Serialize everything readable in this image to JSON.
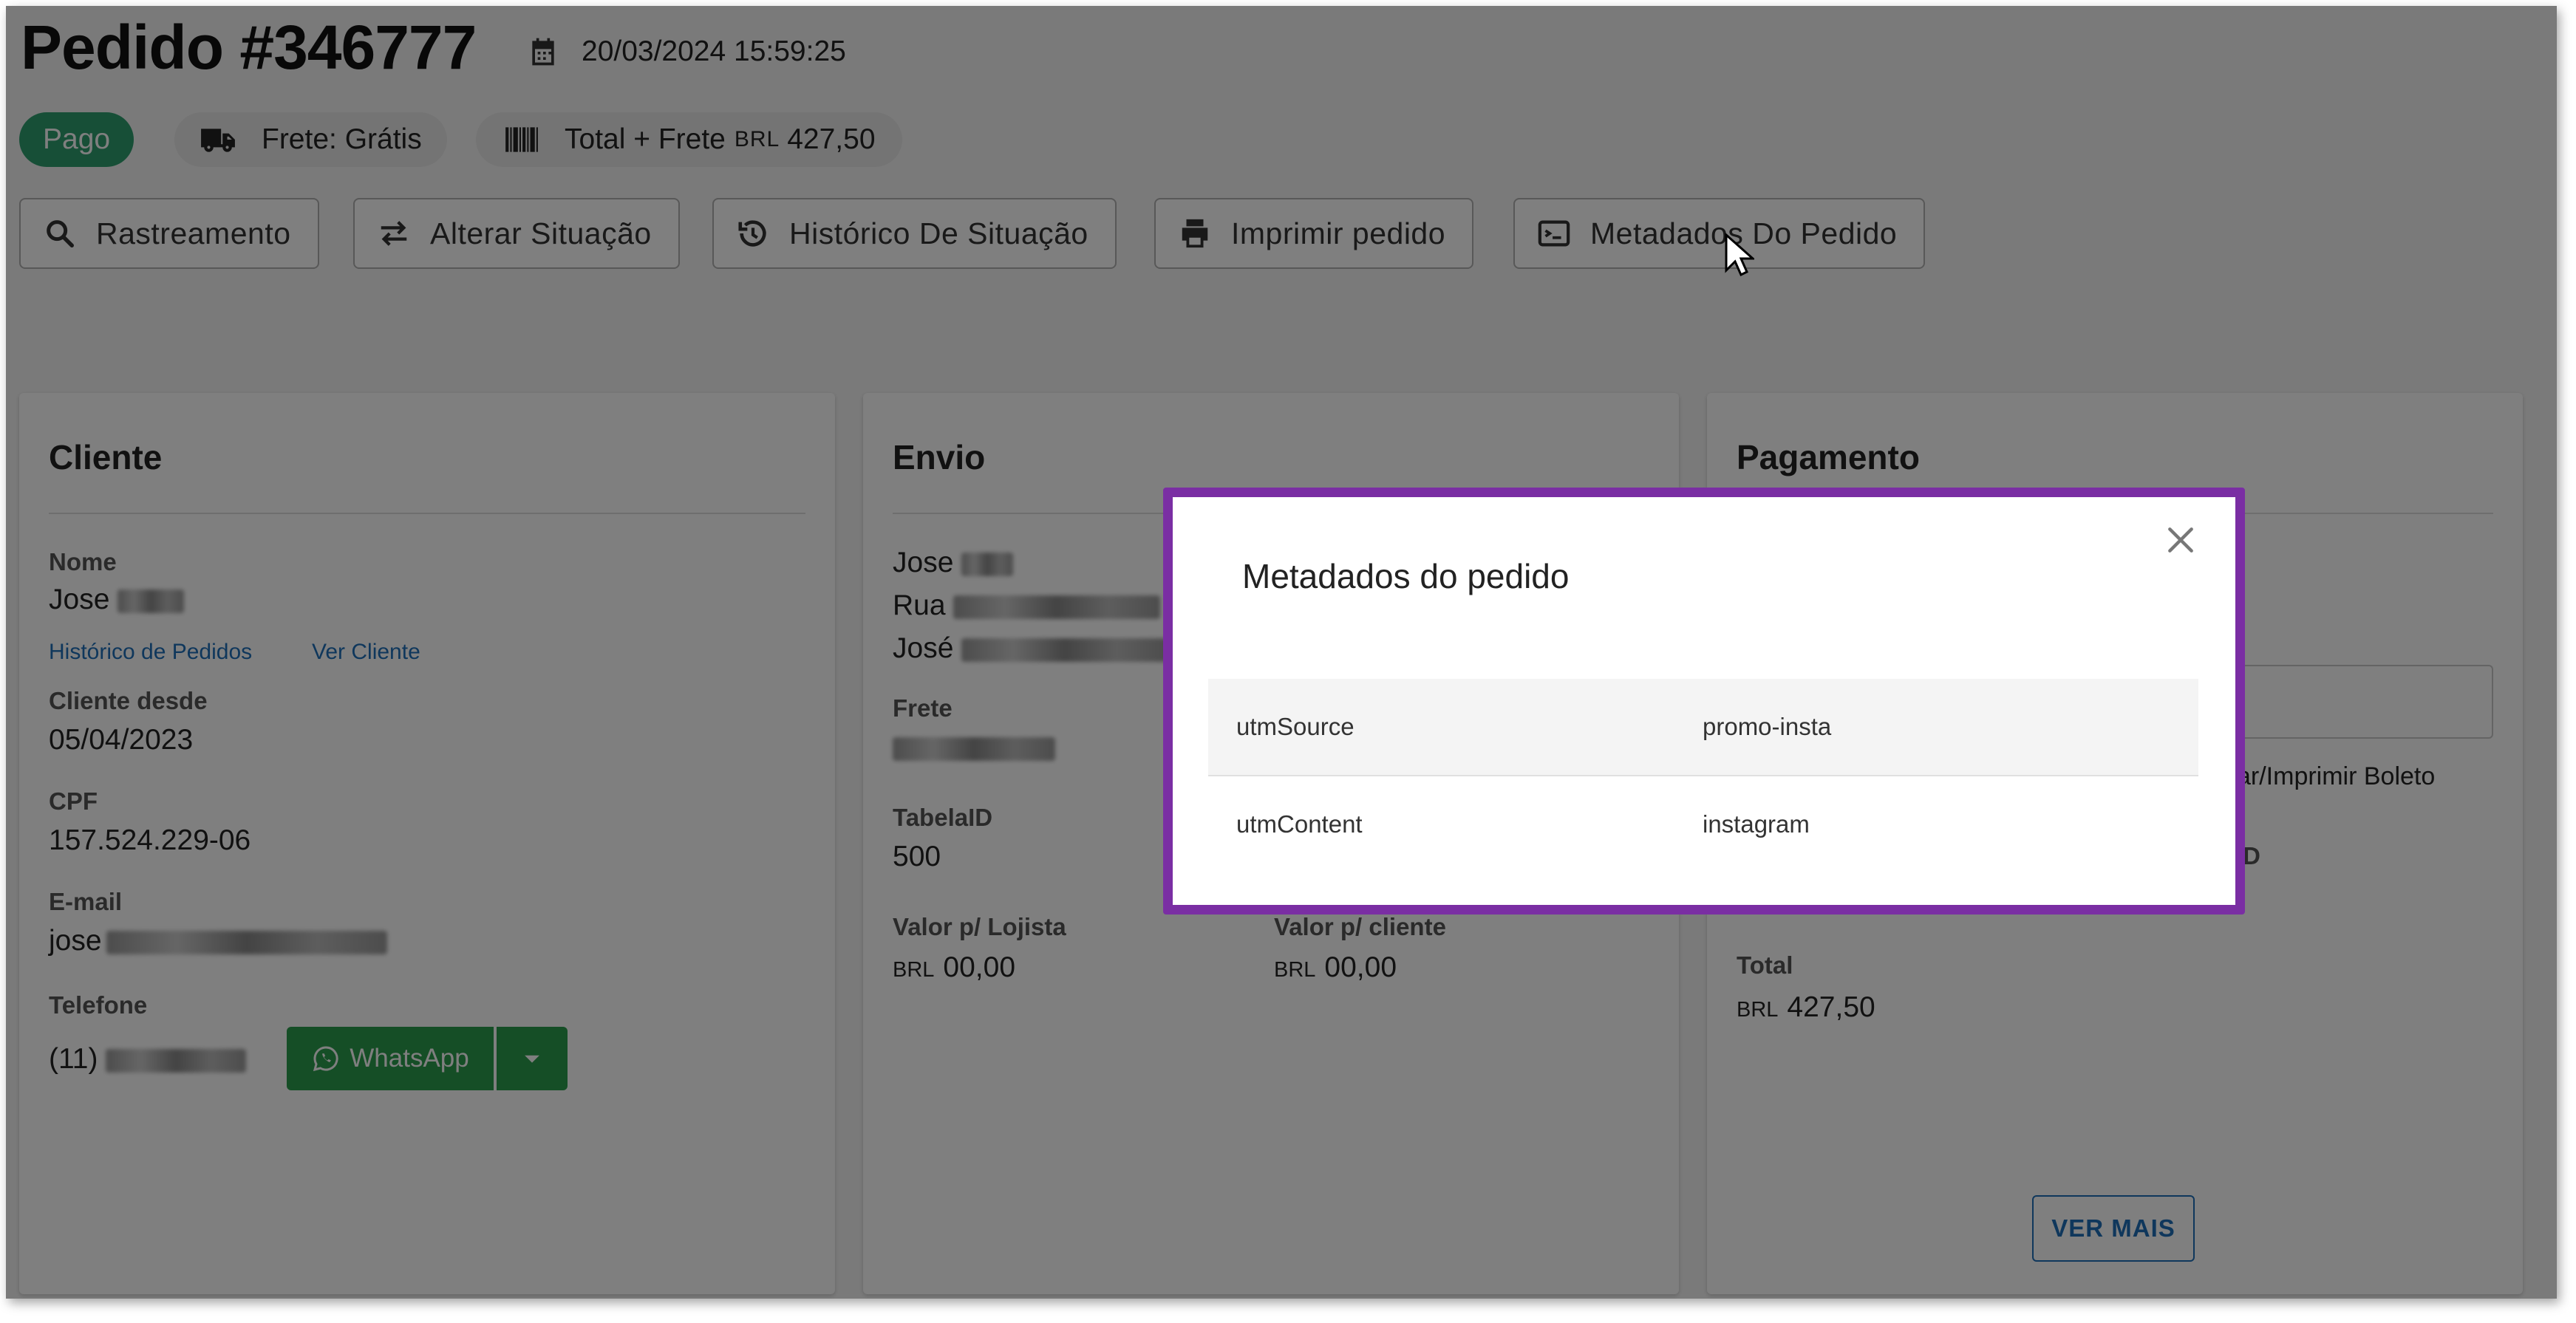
{
  "order": {
    "title": "Pedido #346777",
    "datetime": "20/03/2024 15:59:25",
    "status": "Pago",
    "shipping": "Frete: Grátis",
    "total_label": "Total + Frete",
    "currency": "BRL",
    "total_value": "427,50"
  },
  "toolbar": {
    "tracking": "Rastreamento",
    "change_status": "Alterar Situação",
    "status_history": "Histórico De Situação",
    "print": "Imprimir pedido",
    "metadata": "Metadados Do Pedido"
  },
  "client": {
    "title": "Cliente",
    "name_label": "Nome",
    "name_value": "Jose",
    "orders_history_link": "Histórico de Pedidos",
    "view_client_link": "Ver Cliente",
    "since_label": "Cliente desde",
    "since_value": "05/04/2023",
    "cpf_label": "CPF",
    "cpf_value": "157.524.229-06",
    "email_label": "E-mail",
    "email_value": "jose",
    "phone_label": "Telefone",
    "phone_value": "(11)",
    "whatsapp_label": "WhatsApp"
  },
  "shipping": {
    "title": "Envio",
    "line1": "Jose",
    "line2": "Rua",
    "line3": "José",
    "frete_label": "Frete",
    "table_label": "TabelaID",
    "table_value": "500",
    "store_value_label": "Valor p/ Lojista",
    "store_value": "00,00",
    "client_value_label": "Valor p/ cliente",
    "client_value": "00,00",
    "currency": "BRL"
  },
  "payment": {
    "title": "Pagamento",
    "boleto_link_partial": "zar/Imprimir Boleto",
    "id_partial": "ID",
    "total_label": "Total",
    "total_value": "427,50",
    "currency": "BRL",
    "see_more": "VER MAIS"
  },
  "modal": {
    "title": "Metadados do pedido",
    "rows": [
      {
        "key": "utmSource",
        "value": "promo-insta"
      },
      {
        "key": "utmContent",
        "value": "instagram"
      }
    ]
  },
  "colors": {
    "paid_chip": "#2e9e6e",
    "whatsapp": "#2b9c4c",
    "modal_border": "#7a2ea3",
    "link": "#1e6fb8"
  }
}
